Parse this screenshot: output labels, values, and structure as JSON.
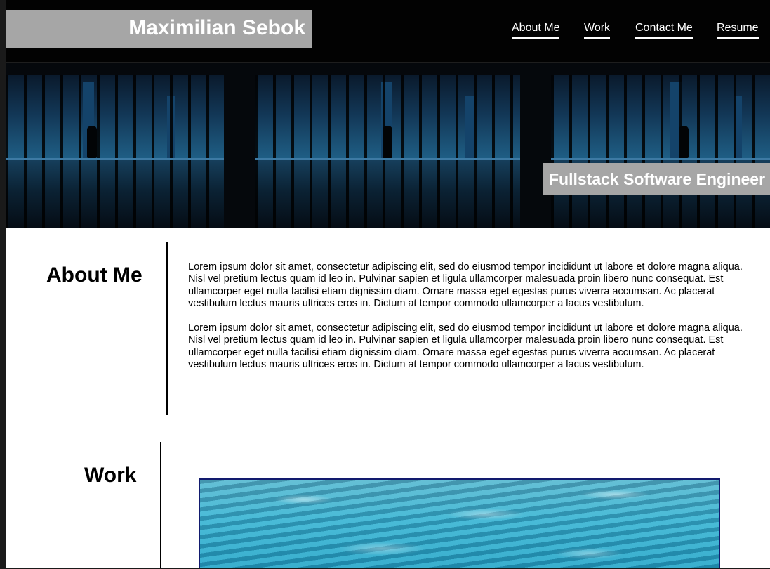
{
  "header": {
    "name": "Maximilian Sebok",
    "nav": [
      {
        "label": "About Me"
      },
      {
        "label": "Work"
      },
      {
        "label": "Contact Me"
      },
      {
        "label": "Resume"
      }
    ]
  },
  "hero": {
    "tagline": "Fullstack Software Engineer"
  },
  "about": {
    "title": "About Me",
    "paragraphs": [
      "Lorem ipsum dolor sit amet, consectetur adipiscing elit, sed do eiusmod tempor incididunt ut labore et dolore magna aliqua. Nisl vel pretium lectus quam id leo in. Pulvinar sapien et ligula ullamcorper malesuada proin libero nunc consequat. Est ullamcorper eget nulla facilisi etiam dignissim diam. Ornare massa eget egestas purus viverra accumsan. Ac placerat vestibulum lectus mauris ultrices eros in. Dictum at tempor commodo ullamcorper a lacus vestibulum.",
      "Lorem ipsum dolor sit amet, consectetur adipiscing elit, sed do eiusmod tempor incididunt ut labore et dolore magna aliqua. Nisl vel pretium lectus quam id leo in. Pulvinar sapien et ligula ullamcorper malesuada proin libero nunc consequat. Est ullamcorper eget nulla facilisi etiam dignissim diam. Ornare massa eget egestas purus viverra accumsan. Ac placerat vestibulum lectus mauris ultrices eros in. Dictum at tempor commodo ullamcorper a lacus vestibulum."
    ]
  },
  "work": {
    "title": "Work"
  },
  "colors": {
    "header_bg": "#020202",
    "label_box": "#a6a6a6",
    "accent_border": "#121a6e"
  }
}
